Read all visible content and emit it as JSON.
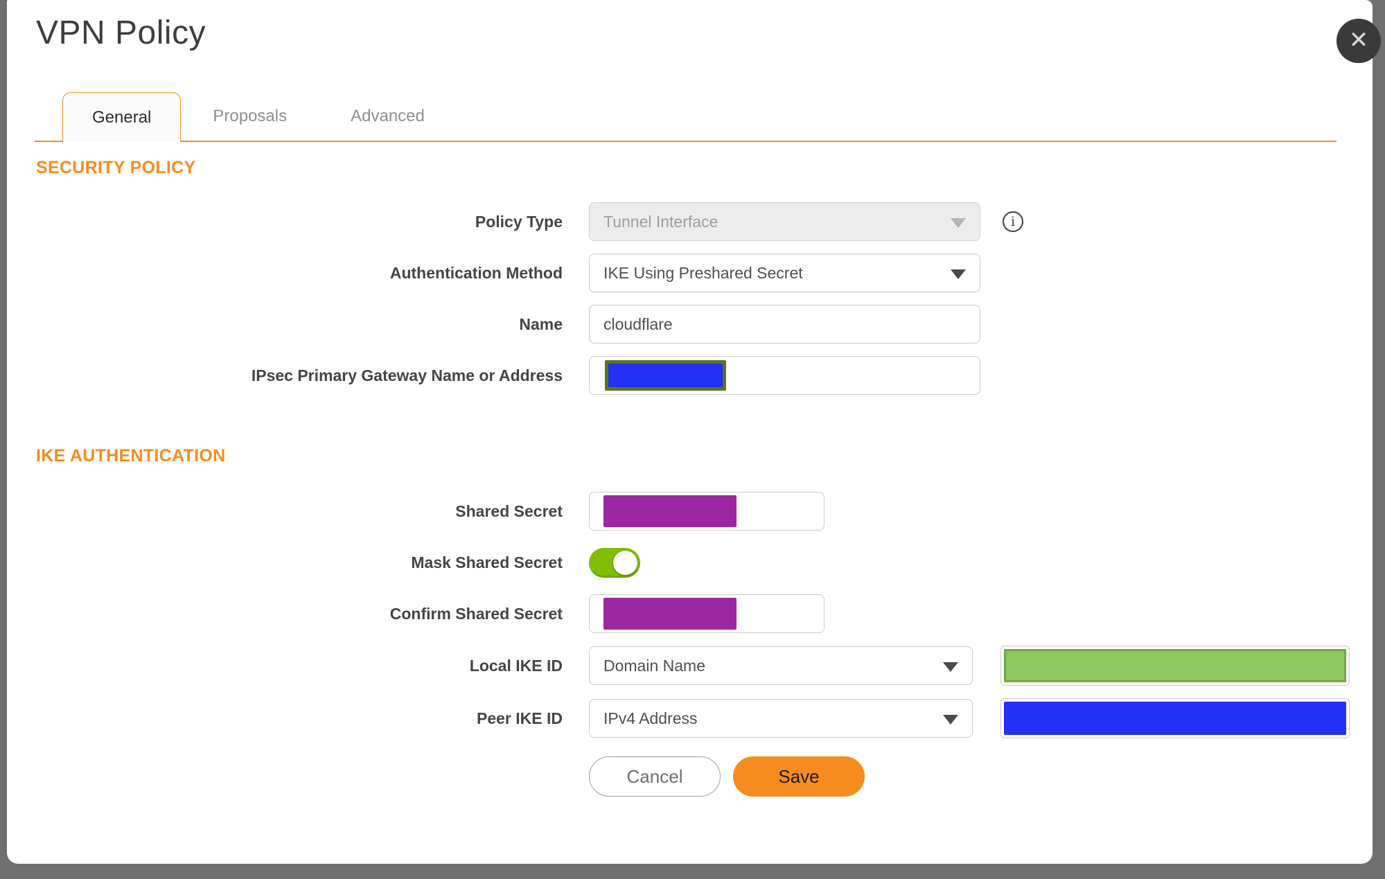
{
  "dialog": {
    "title": "VPN Policy",
    "close_icon": "close-x"
  },
  "tabs": [
    {
      "label": "General",
      "active": true
    },
    {
      "label": "Proposals",
      "active": false
    },
    {
      "label": "Advanced",
      "active": false
    }
  ],
  "sections": {
    "security_policy": {
      "heading": "SECURITY POLICY"
    },
    "ike_authentication": {
      "heading": "IKE AUTHENTICATION"
    }
  },
  "fields": {
    "policy_type": {
      "label": "Policy Type",
      "value": "Tunnel Interface",
      "disabled": true,
      "info_icon": "info-circled-i"
    },
    "authentication_method": {
      "label": "Authentication Method",
      "value": "IKE Using Preshared Secret"
    },
    "name": {
      "label": "Name",
      "value": "cloudflare"
    },
    "ipsec_primary_gateway": {
      "label": "IPsec Primary Gateway Name or Address",
      "value": "",
      "redaction": "blue box with olive border"
    },
    "shared_secret": {
      "label": "Shared Secret",
      "value": "",
      "redaction": "purple box"
    },
    "mask_shared_secret": {
      "label": "Mask Shared Secret",
      "state": "on"
    },
    "confirm_shared_secret": {
      "label": "Confirm Shared Secret",
      "value": "",
      "redaction": "purple box"
    },
    "local_ike_id": {
      "label": "Local IKE ID",
      "value": "Domain Name",
      "redaction": "green box"
    },
    "peer_ike_id": {
      "label": "Peer IKE ID",
      "value": "IPv4 Address",
      "redaction": "blue box"
    }
  },
  "buttons": {
    "cancel": "Cancel",
    "save": "Save"
  },
  "colors": {
    "accent_orange": "#f68c1e",
    "toggle_green": "#7fbe00",
    "redact_purple": "#9c27a0",
    "redact_blue": "#2330f5",
    "redact_green_fill": "#8dc95f",
    "redact_green_border": "#70a844",
    "redact_olive_border": "#55771e",
    "frame_gray": "#6f6f6f",
    "label_text": "#454545"
  }
}
